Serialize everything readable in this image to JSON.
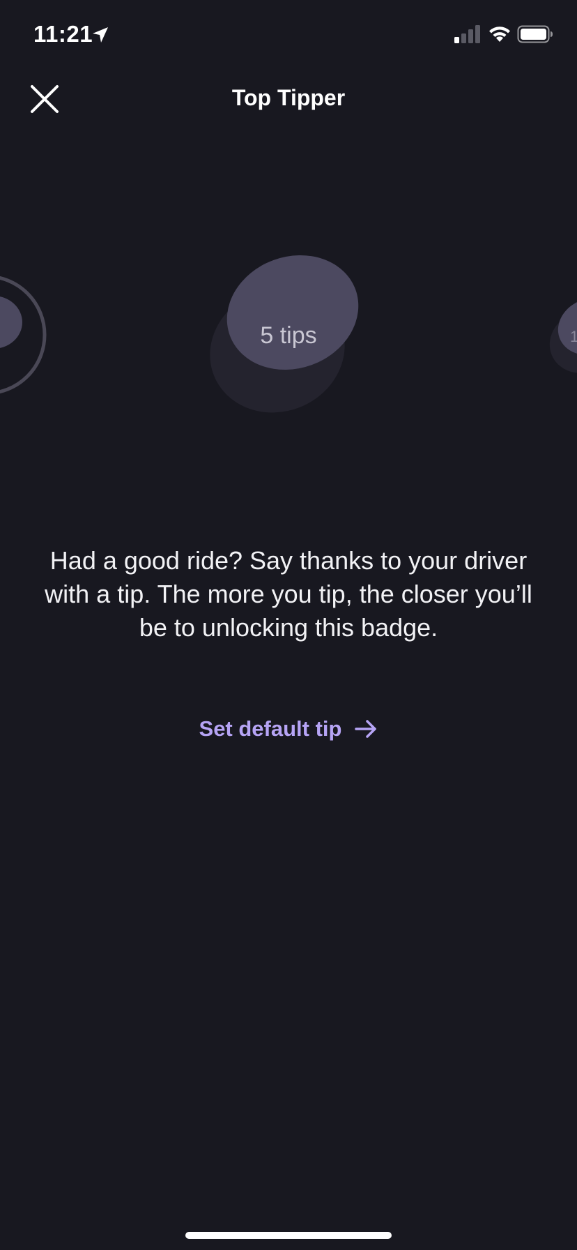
{
  "status_bar": {
    "time": "11:21",
    "icons": [
      "location-arrow-icon",
      "cellular-signal-icon",
      "wifi-icon",
      "battery-icon"
    ]
  },
  "header": {
    "title": "Top Tipper",
    "close_icon": "close-icon"
  },
  "badge": {
    "label": "5 tips",
    "next_badge_label_partial": "1"
  },
  "description": "Had a good ride? Say thanks to your driver with a tip. The more you tip, the closer you’ll be to unlocking this badge.",
  "cta": {
    "label": "Set default tip",
    "icon": "arrow-right-icon"
  },
  "colors": {
    "background": "#181820",
    "accent": "#b6a4f5",
    "badge_front": "#4c4960",
    "badge_back": "#24232e",
    "text": "#ffffff"
  }
}
